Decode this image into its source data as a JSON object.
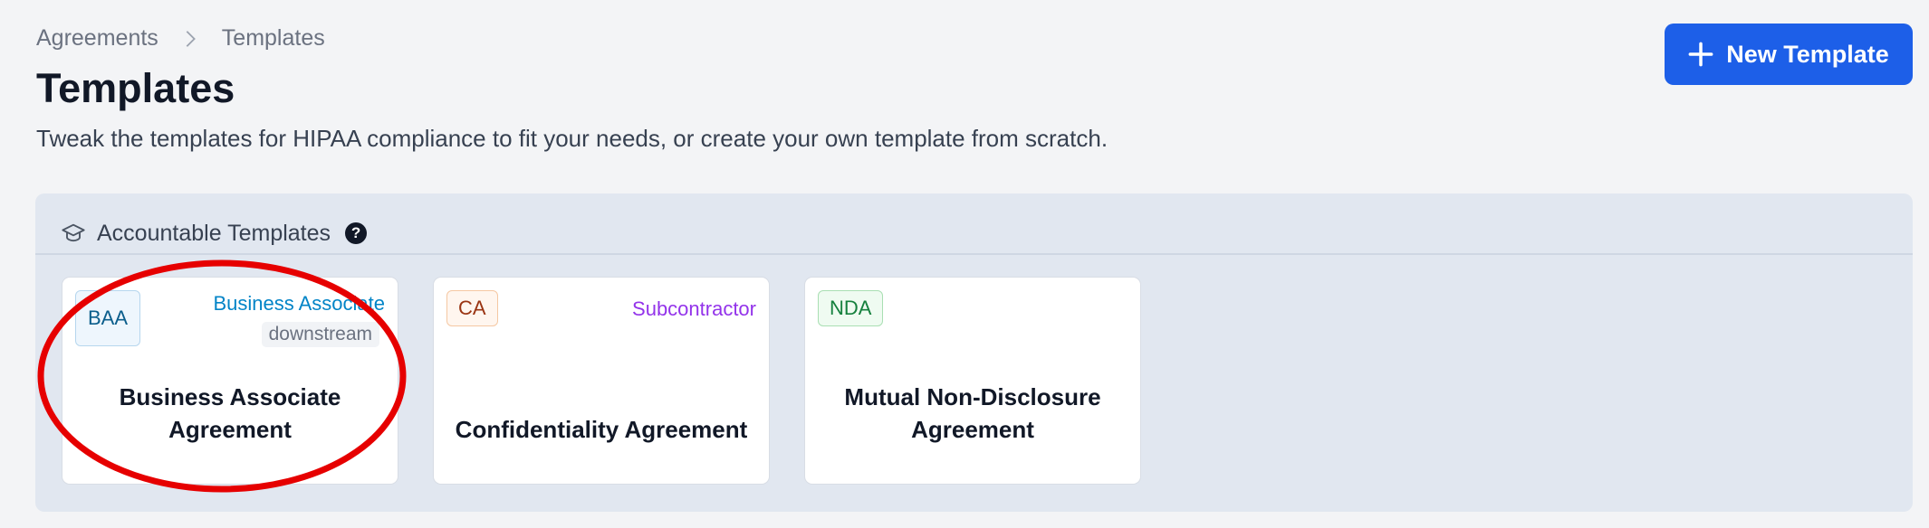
{
  "breadcrumb": {
    "parent": "Agreements",
    "current": "Templates"
  },
  "page": {
    "title": "Templates",
    "subtitle": "Tweak the templates for HIPAA compliance to fit your needs, or create your own template from scratch."
  },
  "actions": {
    "new_template": "New Template"
  },
  "section": {
    "title": "Accountable Templates",
    "help": "?"
  },
  "templates": [
    {
      "badge": "BAA",
      "type": "Business Associate",
      "type_color": "#0284c7",
      "tag": "downstream",
      "title": "Business Associate Agreement"
    },
    {
      "badge": "CA",
      "type": "Subcontractor",
      "type_color": "#9333ea",
      "title": "Confidentiality Agreement"
    },
    {
      "badge": "NDA",
      "title": "Mutual Non-Disclosure Agreement"
    }
  ],
  "colors": {
    "primary": "#1d5fe8",
    "annotation": "#e60000"
  }
}
